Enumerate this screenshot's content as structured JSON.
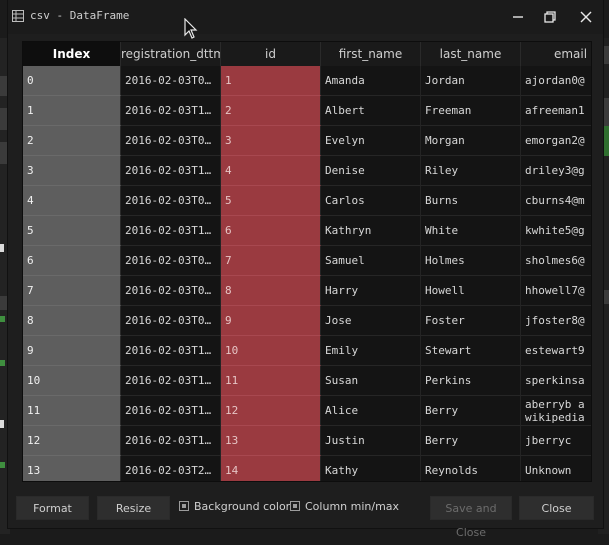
{
  "window": {
    "title": "csv - DataFrame"
  },
  "columns": [
    "Index",
    "registration_dttm",
    "id",
    "first_name",
    "last_name",
    "email"
  ],
  "rows": [
    [
      "0",
      "2016-02-03T0…",
      "1",
      "Amanda",
      "Jordan",
      "ajordan0@"
    ],
    [
      "1",
      "2016-02-03T1…",
      "2",
      "Albert",
      "Freeman",
      "afreeman1"
    ],
    [
      "2",
      "2016-02-03T0…",
      "3",
      "Evelyn",
      "Morgan",
      "emorgan2@"
    ],
    [
      "3",
      "2016-02-03T1…",
      "4",
      "Denise",
      "Riley",
      "driley3@g"
    ],
    [
      "4",
      "2016-02-03T0…",
      "5",
      "Carlos",
      "Burns",
      "cburns4@m"
    ],
    [
      "5",
      "2016-02-03T1…",
      "6",
      "Kathryn",
      "White",
      "kwhite5@g"
    ],
    [
      "6",
      "2016-02-03T0…",
      "7",
      "Samuel",
      "Holmes",
      "sholmes6@"
    ],
    [
      "7",
      "2016-02-03T0…",
      "8",
      "Harry",
      "Howell",
      "hhowell7@"
    ],
    [
      "8",
      "2016-02-03T0…",
      "9",
      "Jose",
      "Foster",
      "jfoster8@"
    ],
    [
      "9",
      "2016-02-03T1…",
      "10",
      "Emily",
      "Stewart",
      "estewart9"
    ],
    [
      "10",
      "2016-02-03T1…",
      "11",
      "Susan",
      "Perkins",
      "sperkinsa"
    ],
    [
      "11",
      "2016-02-03T1…",
      "12",
      "Alice",
      "Berry",
      "aberryb a\nwikipedia"
    ],
    [
      "12",
      "2016-02-03T1…",
      "13",
      "Justin",
      "Berry",
      "jberryc"
    ],
    [
      "13",
      "2016-02-03T2…",
      "14",
      "Kathy",
      "Reynolds",
      "Unknown"
    ]
  ],
  "buttons": {
    "format": "Format",
    "resize": "Resize",
    "save_and_close": "Save and Close",
    "close": "Close"
  },
  "checkboxes": {
    "background_color": "Background color",
    "column_minmax": "Column min/max"
  },
  "colors": {
    "index_cell": "#5e5e5e",
    "id_cell": "#9a3a40",
    "background": "#1e1e1e"
  }
}
